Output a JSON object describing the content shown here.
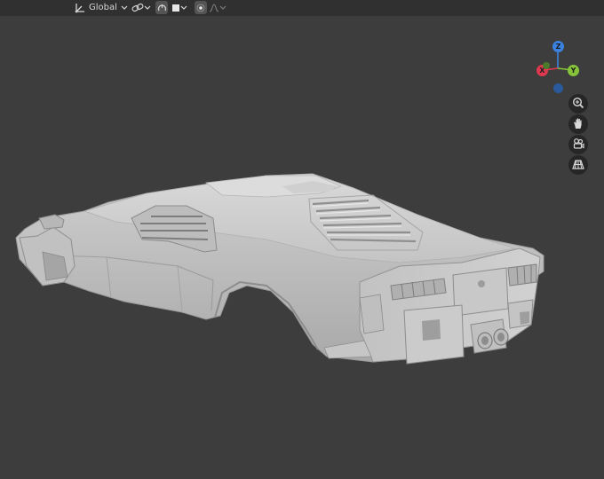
{
  "header": {
    "orientation": {
      "icon": "transform-orientation-icon",
      "label": "Global",
      "dropdown_icon": "chevron-down-icon"
    },
    "pivot": {
      "icon": "link-icon",
      "dropdown_icon": "chevron-down-icon"
    },
    "snap": {
      "icon": "snap-magnet-icon",
      "active": true
    },
    "proportional": {
      "icon": "square-icon",
      "dropdown_icon": "chevron-down-icon"
    },
    "proportional_editing": {
      "icon": "target-dot-icon",
      "active": true
    },
    "falloff": {
      "icon": "falloff-curve-icon",
      "dropdown_icon": "chevron-down-icon"
    }
  },
  "gizmo": {
    "axes": [
      {
        "label": "Z",
        "color": "#3b82e0"
      },
      {
        "label": "X",
        "color": "#e0394f"
      },
      {
        "label": "Y",
        "color": "#86c43a"
      }
    ],
    "negative_colors": [
      "#9a3440",
      "#4a7a2a",
      "#2b5a9c"
    ]
  },
  "navigation": [
    {
      "name": "zoom-icon"
    },
    {
      "name": "hand-pan-icon"
    },
    {
      "name": "camera-icon"
    },
    {
      "name": "grid-perspective-icon"
    }
  ],
  "colors": {
    "viewport": "#3d3d3d",
    "header": "#303030",
    "model": "#c9c9c9"
  }
}
